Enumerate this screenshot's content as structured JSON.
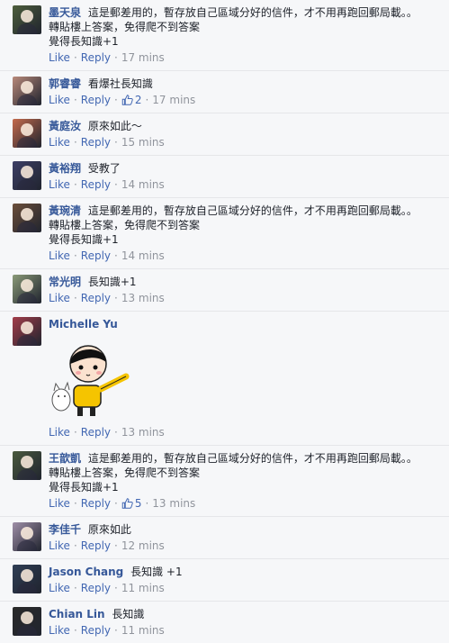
{
  "comments": [
    {
      "name": "墨天泉",
      "text": "這是郵差用的，暫存放自己區域分好的信件，才不用再跑回郵局載。。\n轉貼樓上答案，免得爬不到答案\n覺得長知識+1",
      "like": "Like",
      "reply": "Reply",
      "time": "17 mins",
      "likes": "",
      "avatar": "#4d5e3c"
    },
    {
      "name": "郭睿睿",
      "text": "看爆社長知識",
      "like": "Like",
      "reply": "Reply",
      "time": "17 mins",
      "likes": "2",
      "avatar": "#b8897a"
    },
    {
      "name": "黃庭汝",
      "text": "原來如此～",
      "like": "Like",
      "reply": "Reply",
      "time": "15 mins",
      "likes": "",
      "avatar": "#c46a4c"
    },
    {
      "name": "黃裕翔",
      "text": "受教了",
      "like": "Like",
      "reply": "Reply",
      "time": "14 mins",
      "likes": "",
      "avatar": "#3d3f66"
    },
    {
      "name": "黃琬清",
      "text": "這是郵差用的，暫存放自己區域分好的信件，才不用再跑回郵局載。。\n轉貼樓上答案，免得爬不到答案\n覺得長知識+1",
      "like": "Like",
      "reply": "Reply",
      "time": "14 mins",
      "likes": "",
      "avatar": "#6b4e3a"
    },
    {
      "name": "常光明",
      "text": "長知識+1",
      "like": "Like",
      "reply": "Reply",
      "time": "13 mins",
      "likes": "",
      "avatar": "#8a9a78"
    },
    {
      "name": "Michelle Yu",
      "text": "",
      "like": "Like",
      "reply": "Reply",
      "time": "13 mins",
      "likes": "",
      "sticker": true,
      "avatar": "#a33d4a"
    },
    {
      "name": "王歆凱",
      "text": "這是郵差用的，暫存放自己區域分好的信件，才不用再跑回郵局載。。\n轉貼樓上答案，免得爬不到答案\n覺得長知識+1",
      "like": "Like",
      "reply": "Reply",
      "time": "13 mins",
      "likes": "5",
      "avatar": "#4a5a3e"
    },
    {
      "name": "李佳千",
      "text": "原來如此",
      "like": "Like",
      "reply": "Reply",
      "time": "12 mins",
      "likes": "",
      "avatar": "#9f8fa8"
    },
    {
      "name": "Jason Chang",
      "text": "長知識 +1",
      "like": "Like",
      "reply": "Reply",
      "time": "11 mins",
      "likes": "",
      "avatar": "#2f3e55"
    },
    {
      "name": "Chian Lin",
      "text": "長知識",
      "like": "Like",
      "reply": "Reply",
      "time": "11 mins",
      "likes": "",
      "avatar": "#2a2a2a"
    }
  ],
  "colors": {
    "name": "#365899",
    "link": "#4267b2",
    "meta": "#90949c",
    "background": "#f6f7f9"
  },
  "icons": {
    "like": "thumbs-up-icon"
  }
}
